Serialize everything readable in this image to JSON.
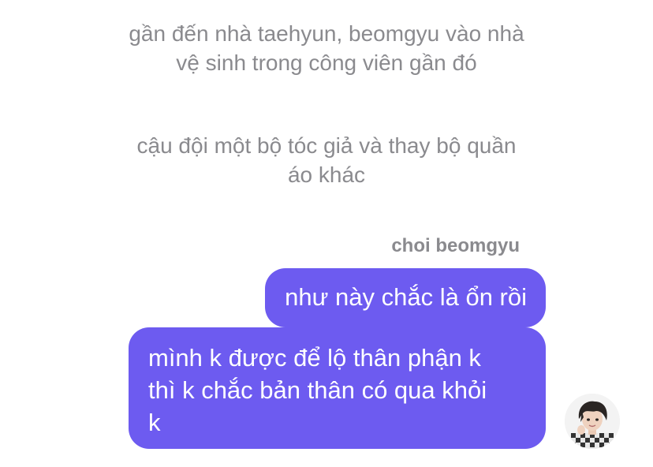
{
  "narration": [
    "gần đến nhà taehyun, beomgyu vào nhà vệ sinh trong công viên gần đó",
    "cậu đội một bộ tóc giả và thay bộ quần áo khác"
  ],
  "narration_lines": {
    "n1_line1": "gần đến nhà taehyun, beomgyu vào nhà",
    "n1_line2": "vệ sinh trong công viên gần đó",
    "n2_line1": "cậu đội một bộ tóc giả và thay bộ quần",
    "n2_line2": "áo khác"
  },
  "chat": {
    "sender_name": "choi beomgyu",
    "messages": [
      {
        "text": "như này chắc là ổn rồi"
      },
      {
        "lines": [
          "mình k được để lộ thân phận k",
          "thì k chắc bản thân có qua khỏi",
          "k"
        ]
      }
    ],
    "avatar_icon": "profile-avatar"
  },
  "colors": {
    "bubble": "#6d5bf0",
    "narration_text": "#8a8a8e",
    "bubble_text": "#ffffff",
    "background": "#ffffff"
  }
}
